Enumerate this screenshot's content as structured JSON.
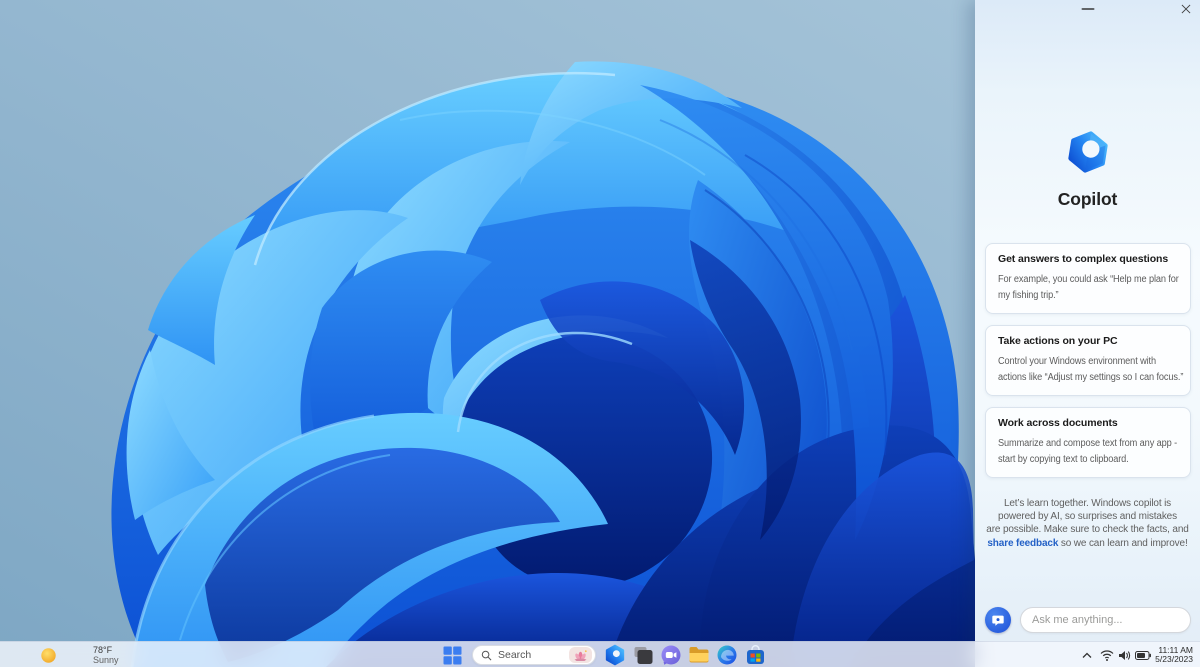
{
  "copilot_panel": {
    "title": "Copilot",
    "cards": [
      {
        "title": "Get answers to complex questions",
        "line1": "For example, you could ask “Help me plan for",
        "line2": "my fishing trip.”"
      },
      {
        "title": "Take actions on your PC",
        "line1": "Control your Windows environment with",
        "line2": "actions like “Adjust my settings so I can focus.”"
      },
      {
        "title": "Work across documents",
        "line1": "Summarize and compose text from any app -",
        "line2": "start by copying text to clipboard."
      }
    ],
    "disclaimer": {
      "line1": "Let’s learn together. Windows copilot is",
      "line2": "powered by AI, so surprises and mistakes",
      "line3": "are possible. Make sure to check the facts, and",
      "link": "share feedback",
      "after": " so we can learn and improve!"
    },
    "input_placeholder": "Ask me anything..."
  },
  "taskbar": {
    "weather": {
      "temperature": "78°F",
      "condition": "Sunny"
    },
    "search_label": "Search",
    "icons": [
      "windows-start",
      "copilot",
      "dark-app-window",
      "chat",
      "file-explorer",
      "edge",
      "microsoft-store"
    ],
    "tray": {
      "time": "11:11 AM",
      "date": "5/23/2023"
    }
  },
  "colors": {
    "accent_blue": "#2563eb",
    "bloom_light": "#40baff",
    "bloom_dark": "#002495",
    "desktop_top": "#a8c6da"
  }
}
